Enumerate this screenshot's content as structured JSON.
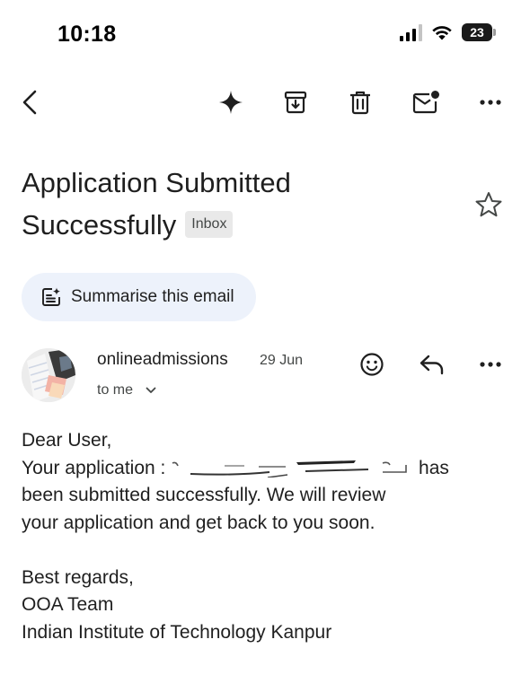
{
  "status_bar": {
    "time": "10:18",
    "battery_level": "23",
    "signal_bars_active": 3,
    "signal_bars_total": 4
  },
  "toolbar": {
    "icons": [
      "back-arrow-icon",
      "gemini-sparkle-icon",
      "archive-icon",
      "trash-icon",
      "mark-unread-icon",
      "more-horizontal-icon"
    ]
  },
  "email": {
    "subject": "Application Submitted Successfully",
    "label": "Inbox",
    "summarise_label": "Summarise this email",
    "sender_name": "onlineadmissions",
    "date": "29 Jun",
    "recipient": "to me",
    "body": {
      "greeting": "Dear User,",
      "line_prefix": "Your application :",
      "line_suffix": "has",
      "line2": "been submitted successfully. We will review",
      "line3": "your application and get back to you soon.",
      "closing": "Best regards,",
      "team": "OOA Team",
      "institution": "Indian Institute of Technology Kanpur"
    }
  },
  "colors": {
    "text_primary": "#1f1f1f",
    "text_secondary": "#444746",
    "chip_background": "#edf2fb",
    "badge_background": "#e9e9e9"
  }
}
